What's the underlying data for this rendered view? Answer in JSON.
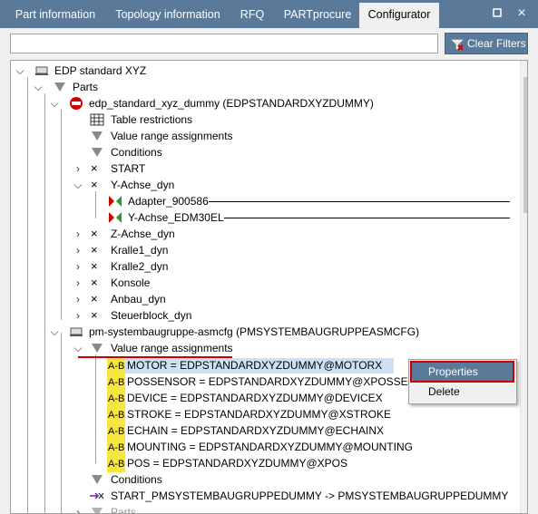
{
  "tabs": [
    {
      "label": "Part information",
      "active": false
    },
    {
      "label": "Topology information",
      "active": false
    },
    {
      "label": "RFQ",
      "active": false
    },
    {
      "label": "PARTprocure",
      "active": false
    },
    {
      "label": "Configurator",
      "active": true
    }
  ],
  "window_buttons": {
    "restore": "▫",
    "close": "×"
  },
  "search": {
    "value": "",
    "placeholder": ""
  },
  "clear_filters_label": "Clear Filters",
  "tree": {
    "root": "EDP standard XYZ",
    "parts": "Parts",
    "dummy": "edp_standard_xyz_dummy (EDPSTANDARDXYZDUMMY)",
    "table_restrictions": "Table restrictions",
    "value_range_assignments_1": "Value range assignments",
    "conditions_1": "Conditions",
    "start": "START",
    "y_achse_dyn": "Y-Achse_dyn",
    "adapter": "Adapter_900586",
    "y_achse_edm": "Y-Achse_EDM30EL",
    "z_achse_dyn": "Z-Achse_dyn",
    "kralle1": "Kralle1_dyn",
    "kralle2": "Kralle2_dyn",
    "konsole": "Konsole",
    "anbau": "Anbau_dyn",
    "steuerblock": "Steuerblock_dyn",
    "pm_asmcfg": "pm-systembaugruppe-asmcfg (PMSYSTEMBAUGRUPPEASMCFG)",
    "value_range_assignments_2": "Value range assignments",
    "ab_tag": "A-B",
    "assignments": [
      "MOTOR = EDPSTANDARDXYZDUMMY@MOTORX",
      "POSSENSOR = EDPSTANDARDXYZDUMMY@XPOSSENSOR",
      "DEVICE = EDPSTANDARDXYZDUMMY@DEVICEX",
      "STROKE = EDPSTANDARDXYZDUMMY@XSTROKE",
      "ECHAIN = EDPSTANDARDXYZDUMMY@ECHAINX",
      "MOUNTING = EDPSTANDARDXYZDUMMY@MOUNTING",
      "POS = EDPSTANDARDXYZDUMMY@XPOS"
    ],
    "conditions_2": "Conditions",
    "start_pm": "START_PMSYSTEMBAUGRUPPEDUMMY -> PMSYSTEMBAUGRUPPEDUMMY",
    "parts_2": "Parts"
  },
  "context_menu": {
    "properties": "Properties",
    "delete": "Delete"
  },
  "colors": {
    "accent": "#5b7a99",
    "highlight_red": "#d00000",
    "ab_yellow": "#f5e642",
    "selection": "#cde1f5"
  }
}
